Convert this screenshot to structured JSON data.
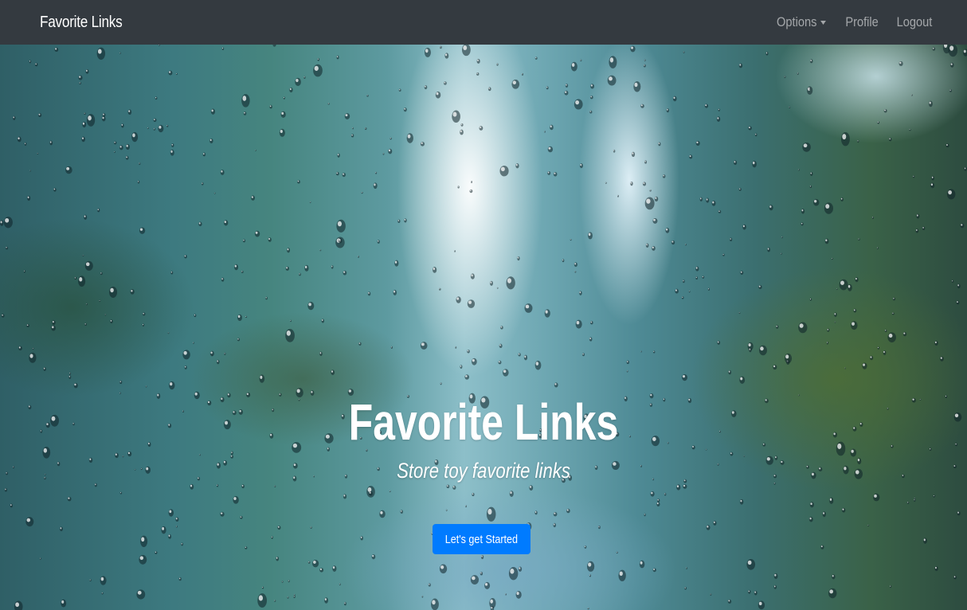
{
  "navbar": {
    "brand": "Favorite Links",
    "links": {
      "options": "Options",
      "profile": "Profile",
      "logout": "Logout"
    }
  },
  "hero": {
    "title": "Favorite Links",
    "subtitle": "Store toy favorite links",
    "cta_label": "Let's get Started"
  },
  "colors": {
    "navbar_bg": "#343a40",
    "cta_bg": "#007bff",
    "text": "#ffffff"
  },
  "icons": {
    "options_dropdown": "caret-down-icon"
  }
}
